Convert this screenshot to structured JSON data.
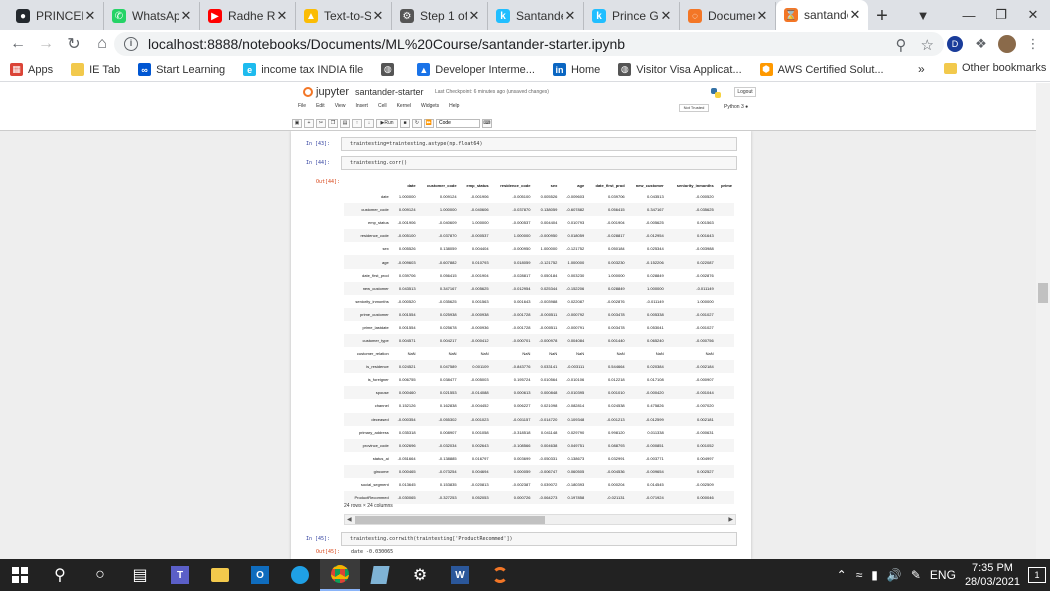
{
  "browser": {
    "tabs": [
      {
        "label": "PRINCEM",
        "icon": "github-icon"
      },
      {
        "label": "WhatsAp",
        "icon": "whatsapp-icon"
      },
      {
        "label": "Radhe Ra",
        "icon": "youtube-icon"
      },
      {
        "label": "Text-to-S",
        "icon": "drive-icon"
      },
      {
        "label": "Step 1 of",
        "icon": "gear-icon"
      },
      {
        "label": "Santande",
        "icon": "kaggle-icon"
      },
      {
        "label": "Prince Gr",
        "icon": "kaggle-icon"
      },
      {
        "label": "Documen",
        "icon": "jupyter-icon"
      },
      {
        "label": "santande",
        "icon": "hourglass-icon"
      }
    ],
    "url": "localhost:8888/notebooks/Documents/ML%20Course/santander-starter.ipynb",
    "bookmarks": [
      {
        "label": "Apps",
        "icon": "apps-icon"
      },
      {
        "label": "IE Tab",
        "icon": "folder-icon"
      },
      {
        "label": "Start Learning",
        "icon": "coursera-icon"
      },
      {
        "label": "income tax INDIA file",
        "icon": "ie-icon"
      },
      {
        "label": "",
        "icon": "globe-icon"
      },
      {
        "label": "Developer Interme...",
        "icon": "developer-icon"
      },
      {
        "label": "Home",
        "icon": "linkedin-icon"
      },
      {
        "label": "Visitor Visa Applicat...",
        "icon": "globe-icon"
      },
      {
        "label": "AWS Certified Solut...",
        "icon": "aws-icon"
      }
    ],
    "bookmarks_more": "»",
    "other_bookmarks": "Other bookmarks"
  },
  "jupyter": {
    "logo": "jupyter",
    "notebook_name": "santander-starter",
    "checkpoint": "Last Checkpoint: 6 minutes ago",
    "unsaved": "(unsaved changes)",
    "logout": "Logout",
    "trusted": "Not Trusted",
    "kernel": "Python 3",
    "menu": [
      "File",
      "Edit",
      "View",
      "Insert",
      "Cell",
      "Kernel",
      "Widgets",
      "Help"
    ],
    "run_label": "Run",
    "cell_type": "Code"
  },
  "cells": {
    "c43": {
      "prompt": "In [43]:",
      "code": "traintesting=traintesting.astype(np.float64)"
    },
    "c44": {
      "prompt": "In [44]:",
      "code": "traintesting.corr()",
      "out_prompt": "Out[44]:"
    },
    "c45": {
      "prompt": "In [45]:",
      "code": "traintesting.corrwith(traintesting['ProductRecommed'])",
      "out_prompt": "Out[45]:",
      "out_line": "date                  -0.030065"
    }
  },
  "table": {
    "columns": [
      "date",
      "customer_code",
      "emp_status",
      "residence_code",
      "sex",
      "age",
      "date_first_prod",
      "new_customer",
      "seniority_inmonths",
      "prime"
    ],
    "rows": [
      {
        "label": "date",
        "values": [
          "1.000000",
          "0.009124",
          "-0.001906",
          "-0.005100",
          "0.005526",
          "-0.009603",
          "0.039706",
          "0.043513",
          "-0.000520",
          ""
        ]
      },
      {
        "label": "customer_code",
        "values": [
          "0.009124",
          "1.000000",
          "-0.040606",
          "-0.037870",
          "0.138059",
          "-0.607882",
          "0.056415",
          "0.347167",
          "-0.035625",
          ""
        ]
      },
      {
        "label": "emp_status",
        "values": [
          "-0.001906",
          "-0.040609",
          "1.000000",
          "-0.000537",
          "0.004404",
          "0.010793",
          "-0.001904",
          "-0.005625",
          "0.001563",
          ""
        ]
      },
      {
        "label": "residence_code",
        "values": [
          "-0.005100",
          "-0.037870",
          "-0.000537",
          "1.000000",
          "-0.000950",
          "0.018059",
          "-0.028817",
          "-0.012954",
          "0.001643",
          ""
        ]
      },
      {
        "label": "sex",
        "values": [
          "0.005526",
          "0.138059",
          "0.004404",
          "-0.000950",
          "1.000000",
          "-0.121752",
          "0.050184",
          "0.025344",
          "-0.003988",
          ""
        ]
      },
      {
        "label": "age",
        "values": [
          "-0.009603",
          "-0.607882",
          "0.010793",
          "0.018059",
          "-0.121752",
          "1.000000",
          "0.003230",
          "-0.152206",
          "0.022087",
          ""
        ]
      },
      {
        "label": "date_first_prod",
        "values": [
          "0.039706",
          "0.056415",
          "-0.001904",
          "-0.028817",
          "0.050184",
          "0.003230",
          "1.000000",
          "0.028849",
          "-0.002876",
          ""
        ]
      },
      {
        "label": "new_customer",
        "values": [
          "0.043513",
          "0.347167",
          "-0.005625",
          "-0.012954",
          "0.025344",
          "-0.152206",
          "0.028849",
          "1.000000",
          "-0.011149",
          ""
        ]
      },
      {
        "label": "seniority_inmonths",
        "values": [
          "-0.000520",
          "-0.035625",
          "0.001563",
          "0.001643",
          "-0.003988",
          "0.022087",
          "-0.002876",
          "-0.011149",
          "1.000000",
          ""
        ]
      },
      {
        "label": "prime_customer",
        "values": [
          "0.001554",
          "0.025938",
          "-0.000938",
          "-0.001728",
          "-0.000511",
          "-0.000792",
          "0.003478",
          "0.005338",
          "-0.001027",
          ""
        ]
      },
      {
        "label": "prime_lastdate",
        "values": [
          "0.001554",
          "0.025678",
          "-0.000936",
          "-0.001728",
          "-0.000511",
          "-0.000791",
          "0.003478",
          "0.053041",
          "-0.001027",
          ""
        ]
      },
      {
        "label": "customer_type",
        "values": [
          "0.004571",
          "0.004217",
          "-0.000412",
          "-0.000701",
          "-0.000978",
          "0.004084",
          "0.001440",
          "0.065240",
          "-0.000756",
          ""
        ]
      },
      {
        "label": "customer_relation",
        "values": [
          "NaN",
          "NaN",
          "NaN",
          "NaN",
          "NaN",
          "NaN",
          "NaN",
          "NaN",
          "NaN",
          ""
        ]
      },
      {
        "label": "is_residence",
        "values": [
          "0.024521",
          "0.047589",
          "0.001109",
          "-0.843776",
          "0.033141",
          "-0.003111",
          "0.544664",
          "0.020384",
          "-0.002184",
          ""
        ]
      },
      {
        "label": "is_foreigner",
        "values": [
          "0.006755",
          "0.038477",
          "-0.005003",
          "0.195724",
          "0.010564",
          "-0.010106",
          "0.012218",
          "0.017108",
          "-0.000907",
          ""
        ]
      },
      {
        "label": "spouse",
        "values": [
          "0.000460",
          "0.021553",
          "-0.014088",
          "0.000613",
          "0.000848",
          "-0.010395",
          "0.001010",
          "-0.000420",
          "-0.001044",
          ""
        ]
      },
      {
        "label": "channel",
        "values": [
          "0.152126",
          "0.162838",
          "-0.004452",
          "0.006227",
          "0.021098",
          "-0.082814",
          "0.024538",
          "0.475826",
          "-0.007020",
          ""
        ]
      },
      {
        "label": "deceased",
        "values": [
          "-0.000354",
          "-0.055302",
          "-0.001023",
          "-0.001157",
          "-0.014720",
          "0.109348",
          "-0.001213",
          "-0.012599",
          "0.002181",
          ""
        ]
      },
      {
        "label": "primary_address",
        "values": [
          "0.035318",
          "0.008907",
          "0.001058",
          "-0.318518",
          "0.041148",
          "0.029790",
          "0.998120",
          "0.011338",
          "-0.000631",
          ""
        ]
      },
      {
        "label": "province_code",
        "values": [
          "0.002696",
          "-0.032034",
          "0.002643",
          "-0.108566",
          "0.004638",
          "0.049751",
          "0.088793",
          "-0.000851",
          "0.001052",
          ""
        ]
      },
      {
        "label": "status_ai",
        "values": [
          "-0.051664",
          "-0.138885",
          "0.016797",
          "0.003699",
          "-0.050331",
          "0.138673",
          "0.032991",
          "-0.003771",
          "0.004997",
          ""
        ]
      },
      {
        "label": "gincome",
        "values": [
          "0.000465",
          "-0.073254",
          "0.004694",
          "0.000059",
          "-0.006747",
          "0.060505",
          "-0.004536",
          "-0.009654",
          "0.002527",
          ""
        ]
      },
      {
        "label": "social_segment",
        "values": [
          "0.013645",
          "0.153835",
          "-0.020813",
          "-0.002387",
          "0.039072",
          "-0.180393",
          "0.000204",
          "0.014545",
          "-0.002509",
          ""
        ]
      },
      {
        "label": "ProductRecommed",
        "values": [
          "-0.030065",
          "-0.327253",
          "0.052053",
          "0.000726",
          "-0.064273",
          "0.197858",
          "-0.021131",
          "-0.071924",
          "0.000046",
          ""
        ]
      }
    ],
    "shape": "24 rows × 24 columns"
  },
  "taskbar": {
    "time": "7:35 PM",
    "date": "28/03/2021",
    "lang": "ENG",
    "notifications": "1"
  }
}
